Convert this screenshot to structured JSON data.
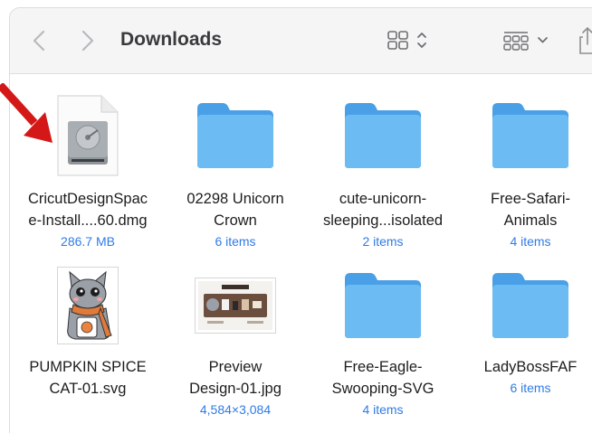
{
  "window": {
    "title": "Downloads"
  },
  "colors": {
    "folder_back": "#4aa0e6",
    "folder_front": "#6cbcf3",
    "meta_text": "#2f7be6",
    "arrow": "#d41818"
  },
  "items": [
    {
      "name_line1": "CricutDesignSpac",
      "name_line2": "e-Install....60.dmg",
      "meta": "286.7 MB",
      "icon": "disk-image-icon"
    },
    {
      "name_line1": "02298 Unicorn",
      "name_line2": "Crown",
      "meta": "6 items",
      "icon": "folder-icon"
    },
    {
      "name_line1": "cute-unicorn-",
      "name_line2": "sleeping...isolated",
      "meta": "2 items",
      "icon": "folder-icon"
    },
    {
      "name_line1": "Free-Safari-",
      "name_line2": "Animals",
      "meta": "4 items",
      "icon": "folder-icon"
    },
    {
      "name_line1": "PUMPKIN SPICE",
      "name_line2": "CAT-01.svg",
      "meta": "",
      "icon": "cat-thumbnail-icon"
    },
    {
      "name_line1": "Preview",
      "name_line2": "Design-01.jpg",
      "meta": "4,584×3,084",
      "icon": "design-thumbnail-icon"
    },
    {
      "name_line1": "Free-Eagle-",
      "name_line2": "Swooping-SVG",
      "meta": "4 items",
      "icon": "folder-icon"
    },
    {
      "name_line1": "LadyBossFAF",
      "name_line2": "",
      "meta": "6 items",
      "icon": "folder-icon"
    }
  ]
}
